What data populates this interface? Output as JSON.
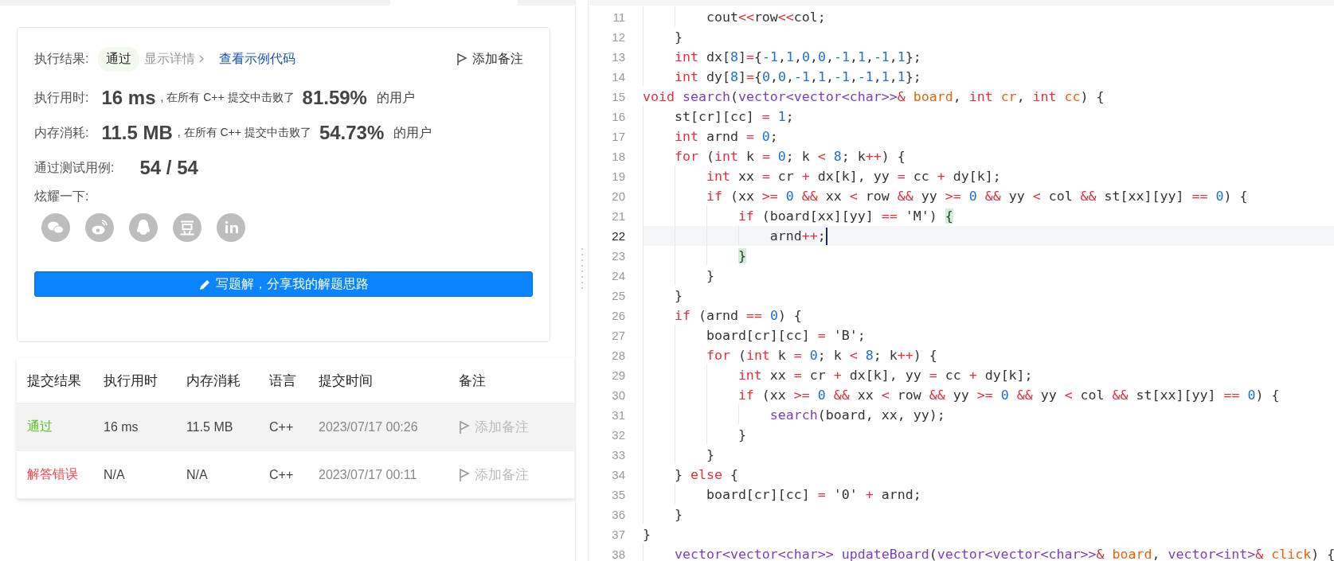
{
  "result": {
    "label": "执行结果:",
    "status": "通过",
    "details": "显示详情",
    "example_link": "查看示例代码",
    "add_note": "添加备注"
  },
  "stats": [
    {
      "label": "执行用时:",
      "value": "16 ms",
      "text": ", 在所有 C++ 提交中击败了",
      "percent": "81.59%",
      "suffix": "的用户"
    },
    {
      "label": "内存消耗:",
      "value": "11.5 MB",
      "text": ", 在所有 C++ 提交中击败了",
      "percent": "54.73%",
      "suffix": "的用户"
    }
  ],
  "tests": {
    "label": "通过测试用例:",
    "value": "54 / 54"
  },
  "share": {
    "label": "炫耀一下:"
  },
  "write_button": "写题解，分享我的解题思路",
  "table": {
    "columns": [
      "提交结果",
      "执行用时",
      "内存消耗",
      "语言",
      "提交时间",
      "备注"
    ],
    "rows": [
      {
        "selected": true,
        "status": "通过",
        "color": "#52c41a",
        "runtime": "16 ms",
        "memory": "11.5 MB",
        "language": "C++",
        "time": "2023/07/17 00:26",
        "note": "添加备注"
      },
      {
        "selected": false,
        "status": "解答错误",
        "color": "#f5414a",
        "runtime": "N/A",
        "memory": "N/A",
        "language": "C++",
        "time": "2023/07/17 00:11",
        "note": "添加备注"
      }
    ]
  },
  "editor": {
    "lines": [
      {
        "number": "11",
        "selected": false,
        "tokens": [
          {
            "t": "        cout",
            "kind": "plain"
          },
          {
            "t": "<<",
            "kind": "op"
          },
          {
            "t": "row",
            "kind": "plain"
          },
          {
            "t": "<<",
            "kind": "op"
          },
          {
            "t": "col;",
            "kind": "plain"
          }
        ]
      },
      {
        "number": "12",
        "selected": false,
        "tokens": [
          {
            "t": "    }",
            "kind": "plain"
          }
        ]
      },
      {
        "number": "13",
        "selected": false,
        "tokens": [
          {
            "t": "    int",
            "kind": "keyword"
          },
          {
            "t": " dx[",
            "kind": "plain"
          },
          {
            "t": "8",
            "kind": "number"
          },
          {
            "t": "]",
            "kind": "plain"
          },
          {
            "t": "=",
            "kind": "op"
          },
          {
            "t": "{",
            "kind": "plain"
          },
          {
            "t": "-1",
            "kind": "number"
          },
          {
            "t": ",",
            "kind": "plain"
          },
          {
            "t": "1",
            "kind": "number"
          },
          {
            "t": ",",
            "kind": "plain"
          },
          {
            "t": "0",
            "kind": "number"
          },
          {
            "t": ",",
            "kind": "plain"
          },
          {
            "t": "0",
            "kind": "number"
          },
          {
            "t": ",",
            "kind": "plain"
          },
          {
            "t": "-1",
            "kind": "number"
          },
          {
            "t": ",",
            "kind": "plain"
          },
          {
            "t": "1",
            "kind": "number"
          },
          {
            "t": ",",
            "kind": "plain"
          },
          {
            "t": "-1",
            "kind": "number"
          },
          {
            "t": ",",
            "kind": "plain"
          },
          {
            "t": "1",
            "kind": "number"
          },
          {
            "t": "};",
            "kind": "plain"
          }
        ]
      },
      {
        "number": "14",
        "selected": false,
        "tokens": [
          {
            "t": "    int",
            "kind": "keyword"
          },
          {
            "t": " dy[",
            "kind": "plain"
          },
          {
            "t": "8",
            "kind": "number"
          },
          {
            "t": "]",
            "kind": "plain"
          },
          {
            "t": "=",
            "kind": "op"
          },
          {
            "t": "{",
            "kind": "plain"
          },
          {
            "t": "0",
            "kind": "number"
          },
          {
            "t": ",",
            "kind": "plain"
          },
          {
            "t": "0",
            "kind": "number"
          },
          {
            "t": ",",
            "kind": "plain"
          },
          {
            "t": "-1",
            "kind": "number"
          },
          {
            "t": ",",
            "kind": "plain"
          },
          {
            "t": "1",
            "kind": "number"
          },
          {
            "t": ",",
            "kind": "plain"
          },
          {
            "t": "-1",
            "kind": "number"
          },
          {
            "t": ",",
            "kind": "plain"
          },
          {
            "t": "-1",
            "kind": "number"
          },
          {
            "t": ",",
            "kind": "plain"
          },
          {
            "t": "1",
            "kind": "number"
          },
          {
            "t": ",",
            "kind": "plain"
          },
          {
            "t": "1",
            "kind": "number"
          },
          {
            "t": "};",
            "kind": "plain"
          }
        ]
      },
      {
        "number": "15",
        "selected": false,
        "tokens": [
          {
            "t": "void",
            "kind": "keyword"
          },
          {
            "t": " search",
            "kind": "type"
          },
          {
            "t": "(",
            "kind": "plain"
          },
          {
            "t": "vector<vector<char>>",
            "kind": "type"
          },
          {
            "t": "&",
            "kind": "op"
          },
          {
            "t": " board",
            "kind": "param"
          },
          {
            "t": ",",
            "kind": "plain"
          },
          {
            "t": " int",
            "kind": "keyword"
          },
          {
            "t": " cr",
            "kind": "param"
          },
          {
            "t": ",",
            "kind": "plain"
          },
          {
            "t": " int",
            "kind": "keyword"
          },
          {
            "t": " cc",
            "kind": "param"
          },
          {
            "t": ") {",
            "kind": "plain"
          }
        ]
      },
      {
        "number": "16",
        "selected": false,
        "tokens": [
          {
            "t": "    st[cr][cc]",
            "kind": "plain"
          },
          {
            "t": " =",
            "kind": "op"
          },
          {
            "t": " 1",
            "kind": "number"
          },
          {
            "t": ";",
            "kind": "plain"
          }
        ]
      },
      {
        "number": "17",
        "selected": false,
        "tokens": [
          {
            "t": "    int",
            "kind": "keyword"
          },
          {
            "t": " arnd",
            "kind": "plain"
          },
          {
            "t": " =",
            "kind": "op"
          },
          {
            "t": " 0",
            "kind": "number"
          },
          {
            "t": ";",
            "kind": "plain"
          }
        ]
      },
      {
        "number": "18",
        "selected": false,
        "tokens": [
          {
            "t": "    for",
            "kind": "keyword"
          },
          {
            "t": " (",
            "kind": "plain"
          },
          {
            "t": "int",
            "kind": "keyword"
          },
          {
            "t": " k",
            "kind": "plain"
          },
          {
            "t": " =",
            "kind": "op"
          },
          {
            "t": " 0",
            "kind": "number"
          },
          {
            "t": "; k",
            "kind": "plain"
          },
          {
            "t": " <",
            "kind": "op"
          },
          {
            "t": " 8",
            "kind": "number"
          },
          {
            "t": "; k",
            "kind": "plain"
          },
          {
            "t": "++",
            "kind": "op"
          },
          {
            "t": ") {",
            "kind": "plain"
          }
        ]
      },
      {
        "number": "19",
        "selected": false,
        "tokens": [
          {
            "t": "        int",
            "kind": "keyword"
          },
          {
            "t": " xx",
            "kind": "plain"
          },
          {
            "t": " =",
            "kind": "op"
          },
          {
            "t": " cr",
            "kind": "plain"
          },
          {
            "t": " +",
            "kind": "op"
          },
          {
            "t": " dx[k], yy",
            "kind": "plain"
          },
          {
            "t": " =",
            "kind": "op"
          },
          {
            "t": " cc",
            "kind": "plain"
          },
          {
            "t": " +",
            "kind": "op"
          },
          {
            "t": " dy[k];",
            "kind": "plain"
          }
        ]
      },
      {
        "number": "20",
        "selected": false,
        "tokens": [
          {
            "t": "        if",
            "kind": "keyword"
          },
          {
            "t": " (xx",
            "kind": "plain"
          },
          {
            "t": " >=",
            "kind": "op"
          },
          {
            "t": " 0",
            "kind": "number"
          },
          {
            "t": " &&",
            "kind": "op"
          },
          {
            "t": " xx",
            "kind": "plain"
          },
          {
            "t": " <",
            "kind": "op"
          },
          {
            "t": " row",
            "kind": "plain"
          },
          {
            "t": " &&",
            "kind": "op"
          },
          {
            "t": " yy",
            "kind": "plain"
          },
          {
            "t": " >=",
            "kind": "op"
          },
          {
            "t": " 0",
            "kind": "number"
          },
          {
            "t": " &&",
            "kind": "op"
          },
          {
            "t": " yy",
            "kind": "plain"
          },
          {
            "t": " <",
            "kind": "op"
          },
          {
            "t": " col",
            "kind": "plain"
          },
          {
            "t": " &&",
            "kind": "op"
          },
          {
            "t": " st[xx][yy]",
            "kind": "plain"
          },
          {
            "t": " ==",
            "kind": "op"
          },
          {
            "t": " 0",
            "kind": "number"
          },
          {
            "t": ") {",
            "kind": "plain"
          }
        ]
      },
      {
        "number": "21",
        "selected": false,
        "tokens": [
          {
            "t": "            if",
            "kind": "keyword"
          },
          {
            "t": " (board[xx][yy]",
            "kind": "plain"
          },
          {
            "t": " ==",
            "kind": "op"
          },
          {
            "t": " 'M')",
            "kind": "plain"
          },
          {
            "t": " {",
            "kind": "match"
          }
        ]
      },
      {
        "number": "22",
        "selected": true,
        "tokens": [
          {
            "t": "                arnd",
            "kind": "plain"
          },
          {
            "t": "++",
            "kind": "op"
          },
          {
            "t": ";",
            "kind": "plain"
          }
        ]
      },
      {
        "number": "23",
        "selected": false,
        "tokens": [
          {
            "t": "            }",
            "kind": "match"
          }
        ]
      },
      {
        "number": "24",
        "selected": false,
        "tokens": [
          {
            "t": "        }",
            "kind": "plain"
          }
        ]
      },
      {
        "number": "25",
        "selected": false,
        "tokens": [
          {
            "t": "    }",
            "kind": "plain"
          }
        ]
      },
      {
        "number": "26",
        "selected": false,
        "tokens": [
          {
            "t": "    if",
            "kind": "keyword"
          },
          {
            "t": " (arnd",
            "kind": "plain"
          },
          {
            "t": " ==",
            "kind": "op"
          },
          {
            "t": " 0",
            "kind": "number"
          },
          {
            "t": ") {",
            "kind": "plain"
          }
        ]
      },
      {
        "number": "27",
        "selected": false,
        "tokens": [
          {
            "t": "        board[cr][cc]",
            "kind": "plain"
          },
          {
            "t": " =",
            "kind": "op"
          },
          {
            "t": " 'B';",
            "kind": "plain"
          }
        ]
      },
      {
        "number": "28",
        "selected": false,
        "tokens": [
          {
            "t": "        for",
            "kind": "keyword"
          },
          {
            "t": " (",
            "kind": "plain"
          },
          {
            "t": "int",
            "kind": "keyword"
          },
          {
            "t": " k",
            "kind": "plain"
          },
          {
            "t": " =",
            "kind": "op"
          },
          {
            "t": " 0",
            "kind": "number"
          },
          {
            "t": "; k",
            "kind": "plain"
          },
          {
            "t": " <",
            "kind": "op"
          },
          {
            "t": " 8",
            "kind": "number"
          },
          {
            "t": "; k",
            "kind": "plain"
          },
          {
            "t": "++",
            "kind": "op"
          },
          {
            "t": ") {",
            "kind": "plain"
          }
        ]
      },
      {
        "number": "29",
        "selected": false,
        "tokens": [
          {
            "t": "            int",
            "kind": "keyword"
          },
          {
            "t": " xx",
            "kind": "plain"
          },
          {
            "t": " =",
            "kind": "op"
          },
          {
            "t": " cr",
            "kind": "plain"
          },
          {
            "t": " +",
            "kind": "op"
          },
          {
            "t": " dx[k], yy",
            "kind": "plain"
          },
          {
            "t": " =",
            "kind": "op"
          },
          {
            "t": " cc",
            "kind": "plain"
          },
          {
            "t": " +",
            "kind": "op"
          },
          {
            "t": " dy[k];",
            "kind": "plain"
          }
        ]
      },
      {
        "number": "30",
        "selected": false,
        "tokens": [
          {
            "t": "            if",
            "kind": "keyword"
          },
          {
            "t": " (xx",
            "kind": "plain"
          },
          {
            "t": " >=",
            "kind": "op"
          },
          {
            "t": " 0",
            "kind": "number"
          },
          {
            "t": " &&",
            "kind": "op"
          },
          {
            "t": " xx",
            "kind": "plain"
          },
          {
            "t": " <",
            "kind": "op"
          },
          {
            "t": " row",
            "kind": "plain"
          },
          {
            "t": " &&",
            "kind": "op"
          },
          {
            "t": " yy",
            "kind": "plain"
          },
          {
            "t": " >=",
            "kind": "op"
          },
          {
            "t": " 0",
            "kind": "number"
          },
          {
            "t": " &&",
            "kind": "op"
          },
          {
            "t": " yy",
            "kind": "plain"
          },
          {
            "t": " <",
            "kind": "op"
          },
          {
            "t": " col",
            "kind": "plain"
          },
          {
            "t": " &&",
            "kind": "op"
          },
          {
            "t": " st[xx][yy]",
            "kind": "plain"
          },
          {
            "t": " ==",
            "kind": "op"
          },
          {
            "t": " 0",
            "kind": "number"
          },
          {
            "t": ") {",
            "kind": "plain"
          }
        ]
      },
      {
        "number": "31",
        "selected": false,
        "tokens": [
          {
            "t": "                search",
            "kind": "type"
          },
          {
            "t": "(board, xx, yy);",
            "kind": "plain"
          }
        ]
      },
      {
        "number": "32",
        "selected": false,
        "tokens": [
          {
            "t": "            }",
            "kind": "plain"
          }
        ]
      },
      {
        "number": "33",
        "selected": false,
        "tokens": [
          {
            "t": "        }",
            "kind": "plain"
          }
        ]
      },
      {
        "number": "34",
        "selected": false,
        "tokens": [
          {
            "t": "    }",
            "kind": "plain"
          },
          {
            "t": " else",
            "kind": "keyword"
          },
          {
            "t": " {",
            "kind": "plain"
          }
        ]
      },
      {
        "number": "35",
        "selected": false,
        "tokens": [
          {
            "t": "        board[cr][cc]",
            "kind": "plain"
          },
          {
            "t": " =",
            "kind": "op"
          },
          {
            "t": " '0'",
            "kind": "plain"
          },
          {
            "t": " +",
            "kind": "op"
          },
          {
            "t": " arnd;",
            "kind": "plain"
          }
        ]
      },
      {
        "number": "36",
        "selected": false,
        "tokens": [
          {
            "t": "    }",
            "kind": "plain"
          }
        ]
      },
      {
        "number": "37",
        "selected": false,
        "tokens": [
          {
            "t": "}",
            "kind": "plain"
          }
        ]
      },
      {
        "number": "38",
        "selected": false,
        "tokens": [
          {
            "t": "    vector<vector<char>>",
            "kind": "type"
          },
          {
            "t": " updateBoard",
            "kind": "type"
          },
          {
            "t": "(",
            "kind": "plain"
          },
          {
            "t": "vector<vector<char>>",
            "kind": "type"
          },
          {
            "t": "&",
            "kind": "op"
          },
          {
            "t": " board",
            "kind": "param"
          },
          {
            "t": ",",
            "kind": "plain"
          },
          {
            "t": " vector<int>",
            "kind": "type"
          },
          {
            "t": "&",
            "kind": "op"
          },
          {
            "t": " click",
            "kind": "param"
          },
          {
            "t": ") {",
            "kind": "plain"
          }
        ]
      }
    ]
  }
}
